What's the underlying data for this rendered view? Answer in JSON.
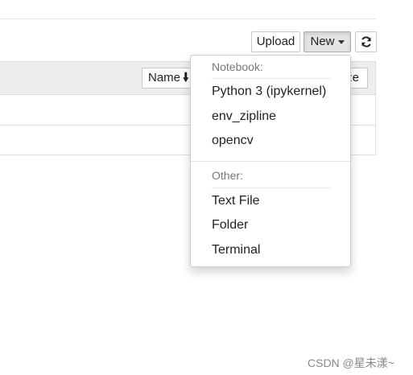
{
  "toolbar": {
    "upload_label": "Upload",
    "new_label": "New",
    "refresh_icon": "refresh-icon"
  },
  "list": {
    "sort_label": "Name",
    "sort_icon": "arrow-down-icon",
    "last_column_fragment": "ze"
  },
  "new_menu": {
    "notebook_header": "Notebook:",
    "notebook_items": [
      "Python 3 (ipykernel)",
      "env_zipline",
      "opencv"
    ],
    "other_header": "Other:",
    "other_items": [
      "Text File",
      "Folder",
      "Terminal"
    ]
  },
  "watermark": "CSDN @星未漾~"
}
